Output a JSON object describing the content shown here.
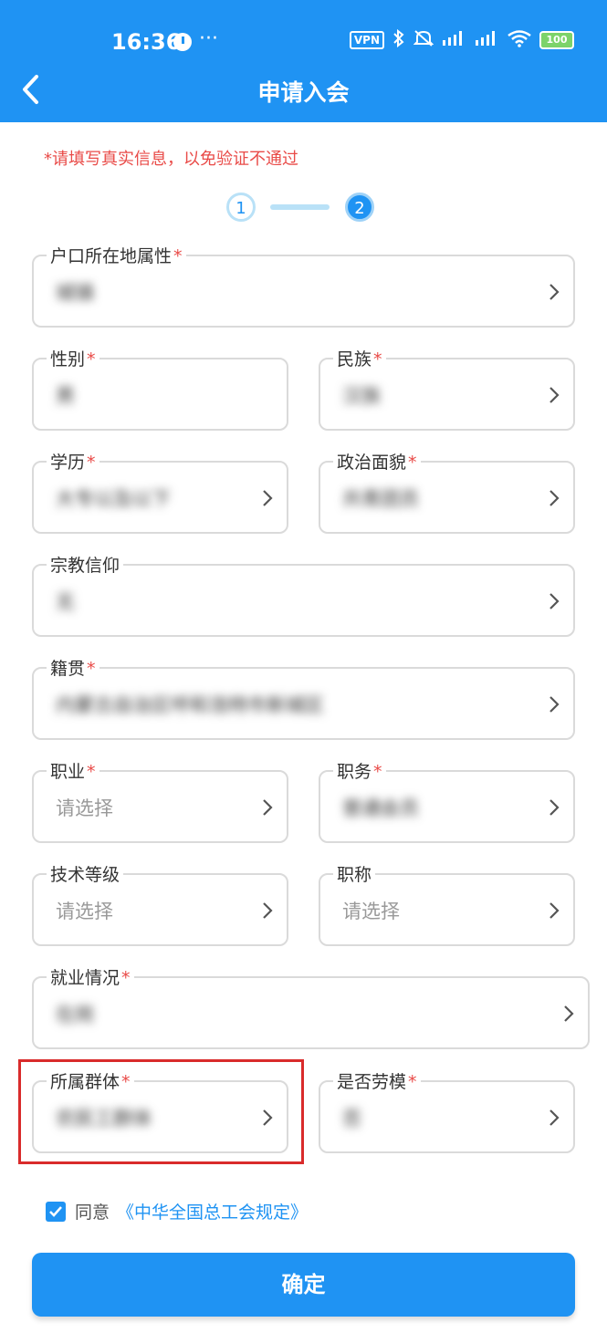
{
  "status_bar": {
    "time": "16:36",
    "more": "···",
    "vpn": "VPN",
    "battery": "100"
  },
  "header": {
    "title": "申请入会"
  },
  "notice": "*请填写真实信息，以免验证不通过",
  "stepper": {
    "step1": "1",
    "step2": "2"
  },
  "fields": {
    "hukou": {
      "label": "户口所在地属性",
      "required": "*",
      "value": "城镇"
    },
    "gender": {
      "label": "性别",
      "required": "*",
      "value": "男"
    },
    "ethnicity": {
      "label": "民族",
      "required": "*",
      "value": "汉族"
    },
    "education": {
      "label": "学历",
      "required": "*",
      "value": "大专以及以下"
    },
    "political": {
      "label": "政治面貌",
      "required": "*",
      "value": "共青团员"
    },
    "religion": {
      "label": "宗教信仰",
      "value": "无"
    },
    "native_place": {
      "label": "籍贯",
      "required": "*",
      "value": "内蒙古自治区呼和浩特市新城区"
    },
    "occupation": {
      "label": "职业",
      "required": "*",
      "placeholder": "请选择"
    },
    "position": {
      "label": "职务",
      "required": "*",
      "value": "普通会员"
    },
    "tech_level": {
      "label": "技术等级",
      "placeholder": "请选择"
    },
    "title": {
      "label": "职称",
      "placeholder": "请选择"
    },
    "employment": {
      "label": "就业情况",
      "required": "*",
      "value": "在岗"
    },
    "group": {
      "label": "所属群体",
      "required": "*",
      "value": "农民工群体"
    },
    "model_worker": {
      "label": "是否劳模",
      "required": "*",
      "value": "否"
    }
  },
  "agreement": {
    "prefix": "同意",
    "link": "《中华全国总工会规定》"
  },
  "confirm_button": "确定",
  "colors": {
    "primary": "#1f93f3",
    "required": "#e94b48",
    "highlight": "#d92b2b"
  }
}
